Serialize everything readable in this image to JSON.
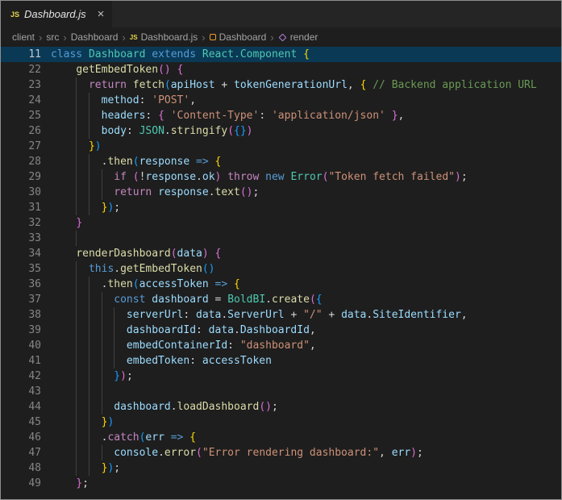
{
  "colors": {
    "bg": "#1e1e1e",
    "panel": "#252526",
    "fg": "#d4d4d4",
    "lineno": "#858585",
    "stickybg": "#0a3956",
    "jsyellow": "#e8d44d",
    "kw": "#569cd6",
    "ctrl": "#c586c0",
    "type": "#4ec9b0",
    "fn": "#dcdcaa",
    "vr": "#9cdcfe",
    "str": "#ce9178",
    "com": "#6a9955",
    "br1": "#ffd700",
    "br2": "#da70d6",
    "br3": "#179fff"
  },
  "tab": {
    "icon_text": "JS",
    "label": "Dashboard.js",
    "close_glyph": "×"
  },
  "breadcrumb": {
    "separator": "›",
    "items": [
      {
        "label": "client"
      },
      {
        "label": "src"
      },
      {
        "label": "Dashboard"
      },
      {
        "label": "Dashboard.js",
        "icon": "js"
      },
      {
        "label": "Dashboard",
        "icon": "class"
      },
      {
        "label": "render",
        "icon": "method"
      }
    ]
  },
  "editor": {
    "sticky_line": {
      "num": "11",
      "tokens": [
        [
          "class",
          "kw"
        ],
        [
          " ",
          "d"
        ],
        [
          "Dashboard",
          "ty"
        ],
        [
          " ",
          "d"
        ],
        [
          "extends",
          "kw"
        ],
        [
          " ",
          "d"
        ],
        [
          "React.Component",
          "ty"
        ],
        [
          " ",
          "d"
        ],
        [
          "{",
          "b1"
        ]
      ]
    },
    "lines": [
      {
        "num": "22",
        "tokens": [
          [
            "    ",
            "d"
          ],
          [
            "getEmbedToken",
            "fn"
          ],
          [
            "()",
            "b2"
          ],
          [
            " ",
            "d"
          ],
          [
            "{",
            "b2"
          ]
        ]
      },
      {
        "num": "23",
        "tokens": [
          [
            "      ",
            "d"
          ],
          [
            "return",
            "ct"
          ],
          [
            " ",
            "d"
          ],
          [
            "fetch",
            "fn"
          ],
          [
            "(",
            "b3"
          ],
          [
            "apiHost",
            "va"
          ],
          [
            " + ",
            "d"
          ],
          [
            "tokenGenerationUrl",
            "va"
          ],
          [
            ", ",
            "d"
          ],
          [
            "{",
            "b1"
          ],
          [
            " ",
            "d"
          ],
          [
            "// Backend application URL",
            "co"
          ]
        ]
      },
      {
        "num": "24",
        "tokens": [
          [
            "        ",
            "d"
          ],
          [
            "method",
            "va"
          ],
          [
            ": ",
            "d"
          ],
          [
            "'POST'",
            "st"
          ],
          [
            ",",
            "d"
          ]
        ]
      },
      {
        "num": "25",
        "tokens": [
          [
            "        ",
            "d"
          ],
          [
            "headers",
            "va"
          ],
          [
            ": ",
            "d"
          ],
          [
            "{",
            "b2"
          ],
          [
            " ",
            "d"
          ],
          [
            "'Content-Type'",
            "st"
          ],
          [
            ": ",
            "d"
          ],
          [
            "'application/json'",
            "st"
          ],
          [
            " ",
            "d"
          ],
          [
            "}",
            "b2"
          ],
          [
            ",",
            "d"
          ]
        ]
      },
      {
        "num": "26",
        "tokens": [
          [
            "        ",
            "d"
          ],
          [
            "body",
            "va"
          ],
          [
            ": ",
            "d"
          ],
          [
            "JSON",
            "ty"
          ],
          [
            ".",
            "d"
          ],
          [
            "stringify",
            "fn"
          ],
          [
            "(",
            "b2"
          ],
          [
            "{}",
            "b3"
          ],
          [
            ")",
            "b2"
          ]
        ]
      },
      {
        "num": "27",
        "tokens": [
          [
            "      ",
            "d"
          ],
          [
            "}",
            "b1"
          ],
          [
            ")",
            "b3"
          ]
        ]
      },
      {
        "num": "28",
        "tokens": [
          [
            "        ",
            "d"
          ],
          [
            ".",
            "d"
          ],
          [
            "then",
            "fn"
          ],
          [
            "(",
            "b3"
          ],
          [
            "response",
            "va"
          ],
          [
            " ",
            "d"
          ],
          [
            "=>",
            "kw"
          ],
          [
            " ",
            "d"
          ],
          [
            "{",
            "b1"
          ]
        ]
      },
      {
        "num": "29",
        "tokens": [
          [
            "          ",
            "d"
          ],
          [
            "if",
            "ct"
          ],
          [
            " ",
            "d"
          ],
          [
            "(",
            "b2"
          ],
          [
            "!",
            "d"
          ],
          [
            "response",
            "va"
          ],
          [
            ".",
            "d"
          ],
          [
            "ok",
            "va"
          ],
          [
            ")",
            "b2"
          ],
          [
            " ",
            "d"
          ],
          [
            "throw",
            "ct"
          ],
          [
            " ",
            "d"
          ],
          [
            "new",
            "kw"
          ],
          [
            " ",
            "d"
          ],
          [
            "Error",
            "ty"
          ],
          [
            "(",
            "b2"
          ],
          [
            "\"Token fetch failed\"",
            "st"
          ],
          [
            ")",
            "b2"
          ],
          [
            ";",
            "d"
          ]
        ]
      },
      {
        "num": "30",
        "tokens": [
          [
            "          ",
            "d"
          ],
          [
            "return",
            "ct"
          ],
          [
            " ",
            "d"
          ],
          [
            "response",
            "va"
          ],
          [
            ".",
            "d"
          ],
          [
            "text",
            "fn"
          ],
          [
            "()",
            "b2"
          ],
          [
            ";",
            "d"
          ]
        ]
      },
      {
        "num": "31",
        "tokens": [
          [
            "        ",
            "d"
          ],
          [
            "}",
            "b1"
          ],
          [
            ")",
            "b3"
          ],
          [
            ";",
            "d"
          ]
        ]
      },
      {
        "num": "32",
        "tokens": [
          [
            "    ",
            "d"
          ],
          [
            "}",
            "b2"
          ]
        ]
      },
      {
        "num": "33",
        "tokens": [],
        "g": [
          4
        ]
      },
      {
        "num": "34",
        "tokens": [
          [
            "    ",
            "d"
          ],
          [
            "renderDashboard",
            "fn"
          ],
          [
            "(",
            "b2"
          ],
          [
            "data",
            "va"
          ],
          [
            ")",
            "b2"
          ],
          [
            " ",
            "d"
          ],
          [
            "{",
            "b2"
          ]
        ]
      },
      {
        "num": "35",
        "tokens": [
          [
            "      ",
            "d"
          ],
          [
            "this",
            "kw"
          ],
          [
            ".",
            "d"
          ],
          [
            "getEmbedToken",
            "fn"
          ],
          [
            "()",
            "b3"
          ]
        ]
      },
      {
        "num": "36",
        "tokens": [
          [
            "        ",
            "d"
          ],
          [
            ".",
            "d"
          ],
          [
            "then",
            "fn"
          ],
          [
            "(",
            "b3"
          ],
          [
            "accessToken",
            "va"
          ],
          [
            " ",
            "d"
          ],
          [
            "=>",
            "kw"
          ],
          [
            " ",
            "d"
          ],
          [
            "{",
            "b1"
          ]
        ]
      },
      {
        "num": "37",
        "tokens": [
          [
            "          ",
            "d"
          ],
          [
            "const",
            "kw"
          ],
          [
            " ",
            "d"
          ],
          [
            "dashboard",
            "va"
          ],
          [
            " = ",
            "d"
          ],
          [
            "BoldBI",
            "ty"
          ],
          [
            ".",
            "d"
          ],
          [
            "create",
            "fn"
          ],
          [
            "(",
            "b2"
          ],
          [
            "{",
            "b3"
          ]
        ]
      },
      {
        "num": "38",
        "tokens": [
          [
            "            ",
            "d"
          ],
          [
            "serverUrl",
            "va"
          ],
          [
            ": ",
            "d"
          ],
          [
            "data",
            "va"
          ],
          [
            ".",
            "d"
          ],
          [
            "ServerUrl",
            "va"
          ],
          [
            " + ",
            "d"
          ],
          [
            "\"/\"",
            "st"
          ],
          [
            " + ",
            "d"
          ],
          [
            "data",
            "va"
          ],
          [
            ".",
            "d"
          ],
          [
            "SiteIdentifier",
            "va"
          ],
          [
            ",",
            "d"
          ]
        ]
      },
      {
        "num": "39",
        "tokens": [
          [
            "            ",
            "d"
          ],
          [
            "dashboardId",
            "va"
          ],
          [
            ": ",
            "d"
          ],
          [
            "data",
            "va"
          ],
          [
            ".",
            "d"
          ],
          [
            "DashboardId",
            "va"
          ],
          [
            ",",
            "d"
          ]
        ]
      },
      {
        "num": "40",
        "tokens": [
          [
            "            ",
            "d"
          ],
          [
            "embedContainerId",
            "va"
          ],
          [
            ": ",
            "d"
          ],
          [
            "\"dashboard\"",
            "st"
          ],
          [
            ",",
            "d"
          ]
        ]
      },
      {
        "num": "41",
        "tokens": [
          [
            "            ",
            "d"
          ],
          [
            "embedToken",
            "va"
          ],
          [
            ": ",
            "d"
          ],
          [
            "accessToken",
            "va"
          ]
        ]
      },
      {
        "num": "42",
        "tokens": [
          [
            "          ",
            "d"
          ],
          [
            "}",
            "b3"
          ],
          [
            ")",
            "b2"
          ],
          [
            ";",
            "d"
          ]
        ]
      },
      {
        "num": "43",
        "tokens": [],
        "g": [
          4,
          6,
          8
        ]
      },
      {
        "num": "44",
        "tokens": [
          [
            "          ",
            "d"
          ],
          [
            "dashboard",
            "va"
          ],
          [
            ".",
            "d"
          ],
          [
            "loadDashboard",
            "fn"
          ],
          [
            "()",
            "b2"
          ],
          [
            ";",
            "d"
          ]
        ]
      },
      {
        "num": "45",
        "tokens": [
          [
            "        ",
            "d"
          ],
          [
            "}",
            "b1"
          ],
          [
            ")",
            "b3"
          ]
        ]
      },
      {
        "num": "46",
        "tokens": [
          [
            "        ",
            "d"
          ],
          [
            ".",
            "d"
          ],
          [
            "catch",
            "ct"
          ],
          [
            "(",
            "b3"
          ],
          [
            "err",
            "va"
          ],
          [
            " ",
            "d"
          ],
          [
            "=>",
            "kw"
          ],
          [
            " ",
            "d"
          ],
          [
            "{",
            "b1"
          ]
        ]
      },
      {
        "num": "47",
        "tokens": [
          [
            "          ",
            "d"
          ],
          [
            "console",
            "va"
          ],
          [
            ".",
            "d"
          ],
          [
            "error",
            "fn"
          ],
          [
            "(",
            "b2"
          ],
          [
            "\"Error rendering dashboard:\"",
            "st"
          ],
          [
            ",",
            "d"
          ],
          [
            " ",
            "d"
          ],
          [
            "err",
            "va"
          ],
          [
            ")",
            "b2"
          ],
          [
            ";",
            "d"
          ]
        ]
      },
      {
        "num": "48",
        "tokens": [
          [
            "        ",
            "d"
          ],
          [
            "}",
            "b1"
          ],
          [
            ")",
            "b3"
          ],
          [
            ";",
            "d"
          ]
        ]
      },
      {
        "num": "49",
        "tokens": [
          [
            "    ",
            "d"
          ],
          [
            "}",
            "b2"
          ],
          [
            ";",
            "d"
          ]
        ]
      }
    ]
  }
}
